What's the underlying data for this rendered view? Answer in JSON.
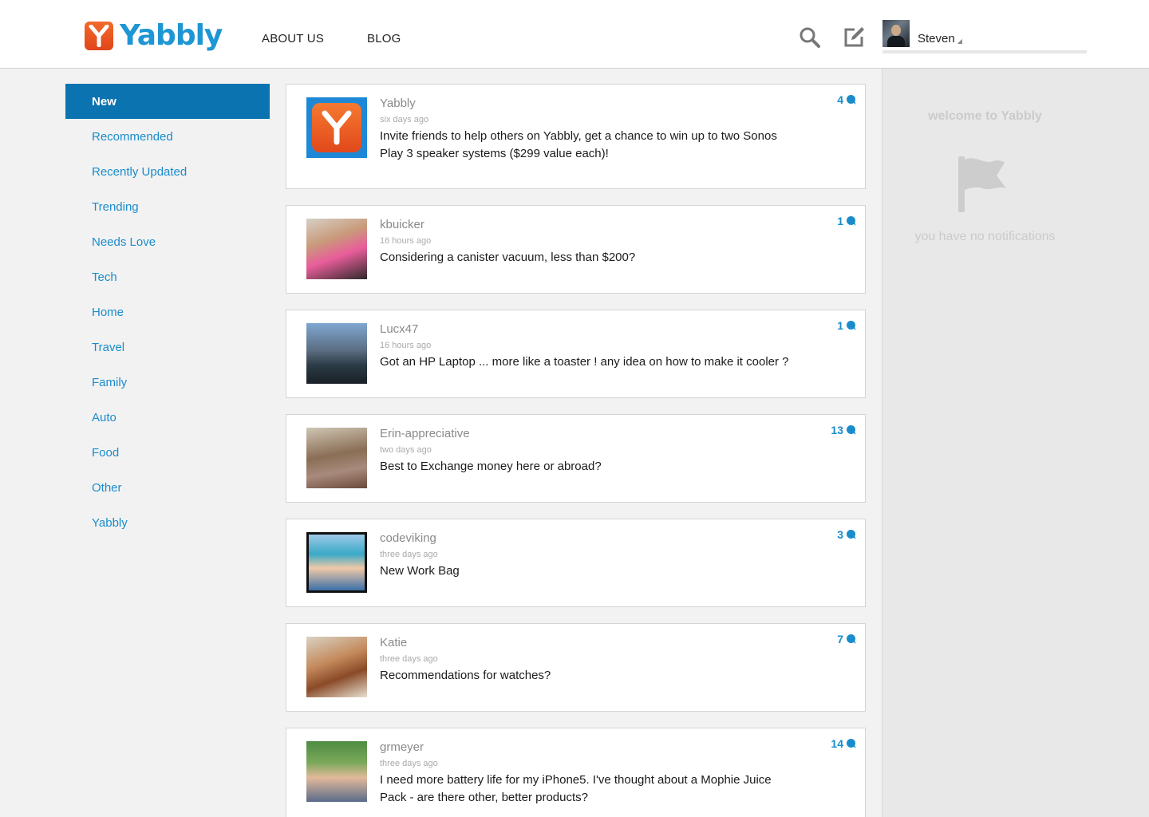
{
  "header": {
    "logo_text": "Yabbly",
    "logo_letter": "Y",
    "nav": {
      "about": "ABOUT US",
      "blog": "BLOG"
    },
    "user": {
      "name": "Steven",
      "caret": "◢"
    },
    "icons": {
      "search": "search-icon",
      "compose": "compose-icon"
    }
  },
  "colors": {
    "brand_blue": "#1e96d4",
    "active_nav": "#0b73b0",
    "logo_orange": "#e85a22"
  },
  "sidebar": {
    "items": [
      {
        "label": "New",
        "active": true
      },
      {
        "label": "Recommended"
      },
      {
        "label": "Recently Updated"
      },
      {
        "label": "Trending"
      },
      {
        "label": "Needs Love"
      },
      {
        "label": "Tech"
      },
      {
        "label": "Home"
      },
      {
        "label": "Travel"
      },
      {
        "label": "Family"
      },
      {
        "label": "Auto"
      },
      {
        "label": "Food"
      },
      {
        "label": "Other"
      },
      {
        "label": "Yabbly"
      }
    ]
  },
  "feed": {
    "posts": [
      {
        "author": "Yabbly",
        "time": "six days ago",
        "title": "Invite friends to help others on Yabbly, get a chance to win up to two Sonos Play 3 speaker systems ($299 value each)!",
        "count": "4"
      },
      {
        "author": "kbuicker",
        "time": "16 hours ago",
        "title": "Considering a canister vacuum, less than $200?",
        "count": "1"
      },
      {
        "author": "Lucx47",
        "time": "16 hours ago",
        "title": "Got an HP Laptop ... more like a toaster ! any idea on how to make it cooler ?",
        "count": "1"
      },
      {
        "author": "Erin-appreciative",
        "time": "two days ago",
        "title": "Best to Exchange money here or abroad?",
        "count": "13"
      },
      {
        "author": "codeviking",
        "time": "three days ago",
        "title": "New Work Bag",
        "count": "3"
      },
      {
        "author": "Katie",
        "time": "three days ago",
        "title": "Recommendations for watches?",
        "count": "7"
      },
      {
        "author": "grmeyer",
        "time": "three days ago",
        "title": "I need more battery life for my iPhone5. I've thought about a Mophie Juice Pack - are there other, better products?",
        "count": "14"
      }
    ]
  },
  "notifications": {
    "welcome": "welcome to Yabbly",
    "empty": "you have no notifications",
    "icon": "flag-icon"
  }
}
